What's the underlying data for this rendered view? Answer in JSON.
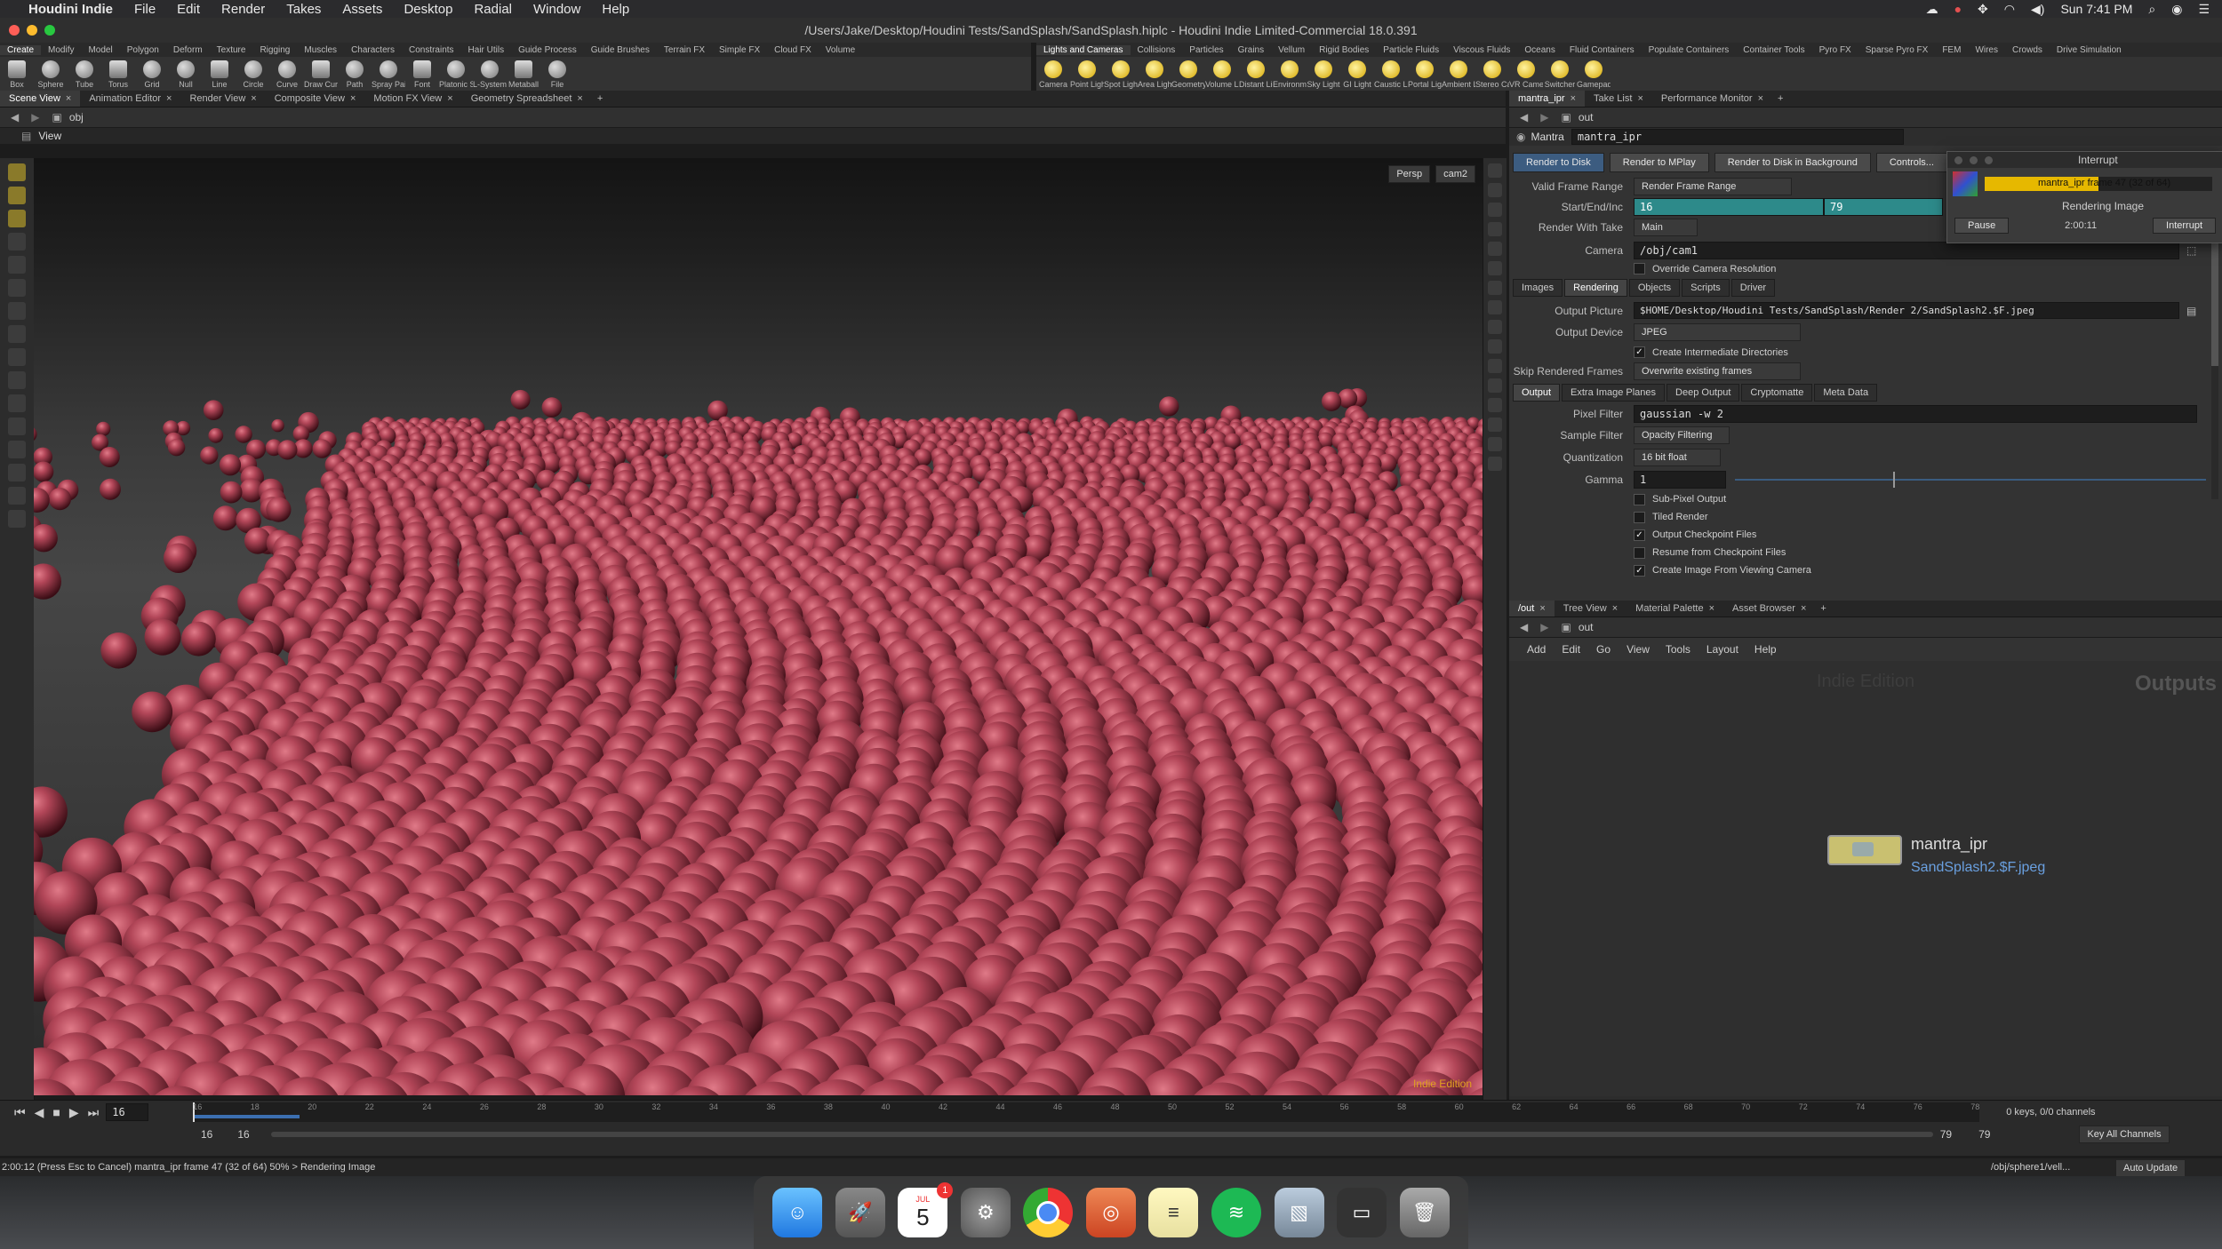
{
  "menubar": {
    "app": "Houdini Indie",
    "items": [
      "File",
      "Edit",
      "Render",
      "Takes",
      "Assets",
      "Desktop",
      "Radial",
      "Window",
      "Help"
    ],
    "clock": "Sun 7:41 PM"
  },
  "window": {
    "title": "/Users/Jake/Desktop/Houdini Tests/SandSplash/SandSplash.hiplc - Houdini Indie Limited-Commercial 18.0.391"
  },
  "shelf_left": {
    "tabs": [
      "Create",
      "Modify",
      "Model",
      "Polygon",
      "Deform",
      "Texture",
      "Rigging",
      "Muscles",
      "Characters",
      "Constraints",
      "Hair Utils",
      "Guide Process",
      "Guide Brushes",
      "Terrain FX",
      "Simple FX",
      "Cloud FX",
      "Volume"
    ],
    "tools": [
      "Box",
      "Sphere",
      "Tube",
      "Torus",
      "Grid",
      "Null",
      "Line",
      "Circle",
      "Curve",
      "Draw Curve",
      "Path",
      "Spray Paint",
      "Font",
      "Platonic Solids",
      "L-System",
      "Metaball",
      "File"
    ]
  },
  "shelf_right": {
    "tabs": [
      "Lights and Cameras",
      "Collisions",
      "Particles",
      "Grains",
      "Vellum",
      "Rigid Bodies",
      "Particle Fluids",
      "Viscous Fluids",
      "Oceans",
      "Fluid Containers",
      "Populate Containers",
      "Container Tools",
      "Pyro FX",
      "Sparse Pyro FX",
      "FEM",
      "Wires",
      "Crowds",
      "Drive Simulation"
    ],
    "tools": [
      "Camera",
      "Point Light",
      "Spot Light",
      "Area Light",
      "Geometry Light",
      "Volume Light",
      "Distant Light",
      "Environment Light",
      "Sky Light",
      "GI Light",
      "Caustic Light",
      "Portal Light",
      "Ambient Light",
      "Stereo Camera",
      "VR Camera",
      "Switcher",
      "Gamepad Camera"
    ]
  },
  "left_pane": {
    "tabs": [
      "Scene View",
      "Animation Editor",
      "Render View",
      "Composite View",
      "Motion FX View",
      "Geometry Spreadsheet"
    ],
    "path": "obj",
    "view_label": "View",
    "persp": "Persp",
    "camera": "cam2",
    "watermark": "Indie Edition"
  },
  "params": {
    "tabs": [
      "mantra_ipr",
      "Take List",
      "Performance Monitor"
    ],
    "path": "out",
    "node_type": "Mantra",
    "node_name": "mantra_ipr",
    "buttons": [
      "Render to Disk",
      "Render to MPlay",
      "Render to Disk in Background",
      "Controls..."
    ],
    "valid_frame_range_label": "Valid Frame Range",
    "valid_frame_range": "Render Frame Range",
    "start_end_label": "Start/End/Inc",
    "start": "16",
    "end": "79",
    "render_take_label": "Render With Take",
    "render_take": "Main",
    "camera_label": "Camera",
    "camera": "/obj/cam1",
    "override_res": "Override Camera Resolution",
    "main_tabs": [
      "Images",
      "Rendering",
      "Objects",
      "Scripts",
      "Driver"
    ],
    "output_picture_label": "Output Picture",
    "output_picture": "$HOME/Desktop/Houdini Tests/SandSplash/Render 2/SandSplash2.$F.jpeg",
    "output_device_label": "Output Device",
    "output_device": "JPEG",
    "create_dirs": "Create Intermediate Directories",
    "skip_frames_label": "Skip Rendered Frames",
    "skip_frames": "Overwrite existing frames",
    "sub_tabs": [
      "Output",
      "Extra Image Planes",
      "Deep Output",
      "Cryptomatte",
      "Meta Data"
    ],
    "pixel_filter_label": "Pixel Filter",
    "pixel_filter": "gaussian -w 2",
    "sample_filter_label": "Sample Filter",
    "sample_filter": "Opacity Filtering",
    "quantization_label": "Quantization",
    "quantization": "16 bit float",
    "gamma_label": "Gamma",
    "gamma": "1",
    "checkboxes": [
      {
        "label": "Sub-Pixel Output",
        "checked": false
      },
      {
        "label": "Tiled Render",
        "checked": false
      },
      {
        "label": "Output Checkpoint Files",
        "checked": true
      },
      {
        "label": "Resume from Checkpoint Files",
        "checked": false
      },
      {
        "label": "Create Image From Viewing Camera",
        "checked": true
      }
    ]
  },
  "interrupt": {
    "title": "Interrupt",
    "progress_text": "mantra_ipr frame 47 (32 of 64)",
    "progress": 0.5,
    "status": "Rendering Image",
    "pause": "Pause",
    "elapsed": "2:00:11",
    "interrupt_btn": "Interrupt"
  },
  "network": {
    "tabs": [
      "/out",
      "Tree View",
      "Material Palette",
      "Asset Browser"
    ],
    "path": "out",
    "menu": [
      "Add",
      "Edit",
      "Go",
      "View",
      "Tools",
      "Layout",
      "Help"
    ],
    "watermark": "Indie Edition",
    "context": "Outputs",
    "node_name": "mantra_ipr",
    "node_output": "SandSplash2.$F.jpeg"
  },
  "timeline": {
    "current_frame": "16",
    "range_start": "16",
    "range_start2": "16",
    "range_end": "79",
    "range_end2": "79",
    "ticks": [
      "16",
      "18",
      "20",
      "22",
      "24",
      "26",
      "28",
      "30",
      "32",
      "34",
      "36",
      "38",
      "40",
      "42",
      "44",
      "46",
      "48",
      "50",
      "52",
      "54",
      "56",
      "58",
      "60",
      "62",
      "64",
      "66",
      "68",
      "70",
      "72",
      "74",
      "76",
      "78"
    ],
    "keys_info": "0 keys, 0/0 channels",
    "key_all": "Key All Channels"
  },
  "statusbar": {
    "message": "2:00:12 (Press Esc to Cancel) mantra_ipr frame 47 (32 of 64) 50% > Rendering Image",
    "path": "/obj/sphere1/vell...",
    "auto_update": "Auto Update"
  },
  "dock": {
    "calendar_month": "JUL",
    "calendar_day": "5",
    "calendar_badge": "1"
  },
  "colors": {
    "sphere": "#a23848",
    "accent_blue": "#3c5c80",
    "teal_field": "#2d8a8a",
    "progress_yellow": "#e6b800",
    "watermark_orange": "#e0a020",
    "link_blue": "#6aa0e0"
  }
}
